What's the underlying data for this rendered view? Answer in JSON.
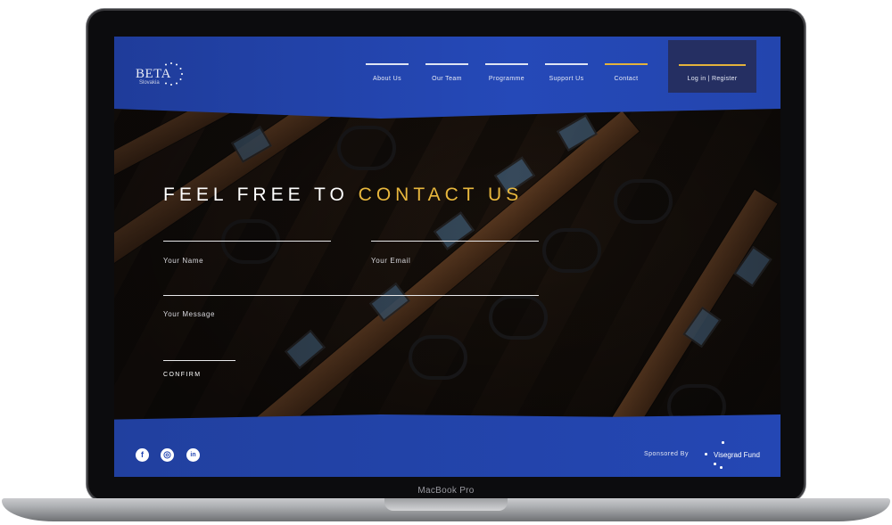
{
  "device": {
    "label": "MacBook Pro"
  },
  "header": {
    "logo": {
      "word": "BETA",
      "sub": "Slovakia"
    },
    "nav": [
      {
        "label": "About Us",
        "active": false
      },
      {
        "label": "Our Team",
        "active": false
      },
      {
        "label": "Programme",
        "active": false
      },
      {
        "label": "Support Us",
        "active": false
      },
      {
        "label": "Contact",
        "active": true
      }
    ],
    "login_label": "Log in | Register"
  },
  "contact": {
    "title_part1": "FEEL FREE TO ",
    "title_part2": "CONTACT US",
    "name_label": "Your Name",
    "email_label": "Your Email",
    "message_label": "Your Message",
    "confirm_label": "CONFIRM"
  },
  "footer": {
    "social": [
      {
        "icon": "facebook-icon",
        "glyph": "f"
      },
      {
        "icon": "instagram-icon",
        "glyph": "◎"
      },
      {
        "icon": "linkedin-icon",
        "glyph": "in"
      }
    ],
    "sponsored_label": "Sponsored By",
    "sponsor_name": "Visegrad Fund"
  },
  "colors": {
    "brand_blue": "#2447b4",
    "accent_gold": "#e8b73d",
    "login_bg": "#252f62"
  }
}
